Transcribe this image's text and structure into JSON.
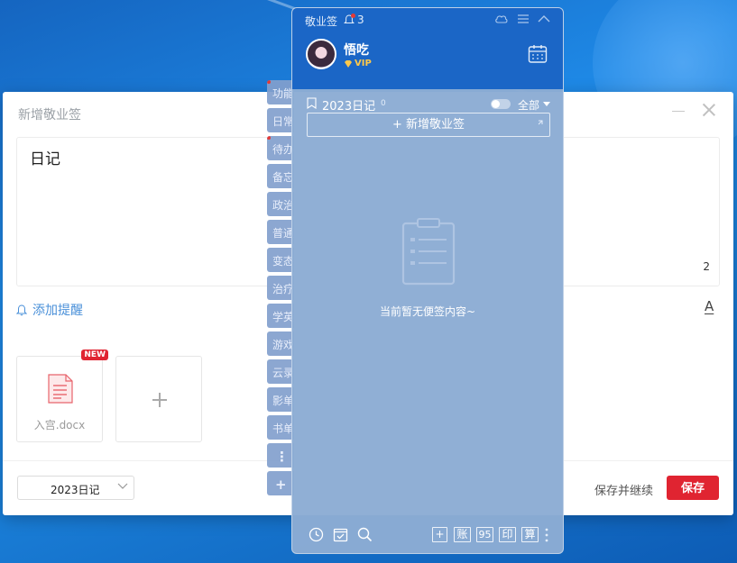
{
  "editor": {
    "title": "新增敬业签",
    "text": "日记",
    "char_count": "2",
    "add_reminder_label": "添加提醒",
    "font_tool": "A",
    "attachment": {
      "name": "入宫.docx",
      "badge": "NEW"
    },
    "notebook": "2023日记",
    "save_continue_label": "保存并继续",
    "save_label": "保存"
  },
  "tabs": [
    "功能",
    "日常",
    "待办",
    "备忘",
    "政治",
    "普通",
    "变态",
    "治疗",
    "学英",
    "游戏",
    "云录",
    "影单",
    "书单"
  ],
  "tab_more": "⋮",
  "tab_add": "+",
  "panel": {
    "app_name": "敬业签",
    "notification_count": "3",
    "user": {
      "name": "悟吃",
      "vip_label": "VIP"
    },
    "notebook_title": "2023日记",
    "notebook_count": "0",
    "filter_label": "全部",
    "add_note_label": "+ 新增敬业签",
    "empty_text": "当前暂无便签内容~",
    "footer_buttons": [
      "+",
      "账",
      "95",
      "印",
      "算"
    ]
  },
  "colors": {
    "accent_red": "#e02431",
    "panel_header": "#1b66c6",
    "link_blue": "#4a90d9",
    "vip_gold": "#ffc94a"
  }
}
